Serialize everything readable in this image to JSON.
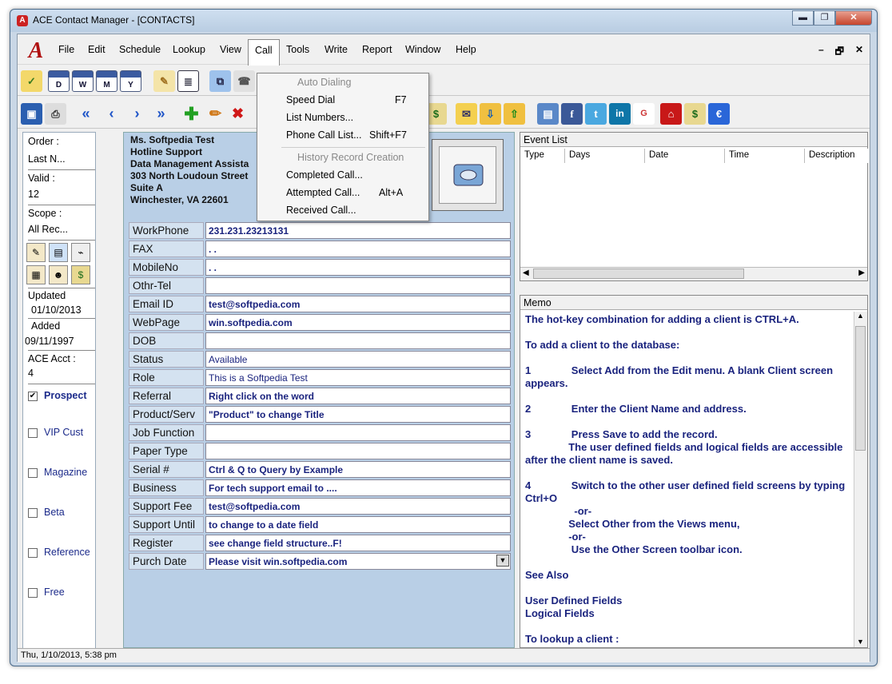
{
  "window": {
    "title": "ACE Contact Manager - [CONTACTS]",
    "min": "▬",
    "restore": "❐",
    "close": "✕",
    "mdi_min": "–",
    "mdi_restore": "🗗",
    "mdi_close": "✕"
  },
  "menu": [
    "File",
    "Edit",
    "Schedule",
    "Lookup",
    "View",
    "Call",
    "Tools",
    "Write",
    "Report",
    "Window",
    "Help"
  ],
  "call_menu": {
    "items": [
      {
        "label": "Auto Dialing",
        "key": "",
        "disabled": true
      },
      {
        "label": "Speed Dial",
        "key": "F7",
        "disabled": false
      },
      {
        "label": "List Numbers...",
        "key": "",
        "disabled": false
      },
      {
        "label": "Phone Call List...",
        "key": "Shift+F7",
        "disabled": false
      },
      {
        "label": "History Record Creation",
        "key": "",
        "disabled": true
      },
      {
        "label": "Completed Call...",
        "key": "",
        "disabled": false
      },
      {
        "label": "Attempted Call...",
        "key": "Alt+A",
        "disabled": false
      },
      {
        "label": "Received Call...",
        "key": "",
        "disabled": false
      }
    ]
  },
  "toolbar1": {
    "calendar_labels": [
      "D",
      "W",
      "M",
      "Y"
    ]
  },
  "left_panel": {
    "order_label": "Order :",
    "order_value": "Last N...",
    "valid_label": "Valid :",
    "valid_value": "12",
    "scope_label": "Scope :",
    "scope_value": "All Rec...",
    "updated_label": "Updated",
    "updated_value": "01/10/2013",
    "added_label": "Added",
    "added_value": "09/11/1997",
    "acct_label": "ACE Acct :",
    "acct_value": "4",
    "checkboxes": [
      {
        "label": "Prospect",
        "checked": true
      },
      {
        "label": "VIP Cust",
        "checked": false
      },
      {
        "label": "Magazine",
        "checked": false
      },
      {
        "label": "Beta",
        "checked": false
      },
      {
        "label": "Reference",
        "checked": false
      },
      {
        "label": "Free",
        "checked": false
      }
    ]
  },
  "contact": {
    "address_lines": [
      "Ms. Softpedia Test",
      "Hotline Support",
      "Data Management Assista",
      "303 North Loudoun Street",
      "Suite A",
      "Winchester, VA 22601"
    ]
  },
  "fields": [
    {
      "label": "WorkPhone",
      "value": "231.231.23213131",
      "bold": true
    },
    {
      "label": "FAX",
      "value": " .  .",
      "bold": true
    },
    {
      "label": "MobileNo",
      "value": " .  .",
      "bold": true
    },
    {
      "label": "Othr-Tel",
      "value": "",
      "bold": true
    },
    {
      "label": "Email ID",
      "value": "test@softpedia.com",
      "bold": true
    },
    {
      "label": "WebPage",
      "value": "win.softpedia.com",
      "bold": true
    },
    {
      "label": "DOB",
      "value": "",
      "bold": true
    },
    {
      "label": "Status",
      "value": "Available",
      "bold": false
    },
    {
      "label": "Role",
      "value": "This is a Softpedia Test",
      "bold": false
    },
    {
      "label": "Referral",
      "value": "Right click on the word",
      "bold": true
    },
    {
      "label": "Product/Serv",
      "value": "\"Product\" to change Title",
      "bold": true
    },
    {
      "label": "Job Function",
      "value": "",
      "bold": true
    },
    {
      "label": "Paper Type",
      "value": "",
      "bold": true
    },
    {
      "label": "Serial #",
      "value": "Ctrl & Q to Query by Example",
      "bold": true
    },
    {
      "label": "Business",
      "value": "For tech support email to ....",
      "bold": true
    },
    {
      "label": "Support Fee",
      "value": "test@softpedia.com",
      "bold": true
    },
    {
      "label": "Support Until",
      "value": "to change to a date field",
      "bold": true
    },
    {
      "label": "Register",
      "value": "see change field structure..F!",
      "bold": true
    },
    {
      "label": "Purch Date",
      "value": "Please visit win.softpedia.com",
      "bold": true
    }
  ],
  "event_list": {
    "title": "Event List",
    "columns": [
      "Type",
      "Days",
      "Date",
      "Time",
      "Description"
    ]
  },
  "memo": {
    "title": "Memo",
    "paragraphs": [
      "The hot-key combination for adding a client is CTRL+A.",
      "To add a client to the database:",
      "1              Select Add from the Edit menu. A blank Client screen appears.",
      "2              Enter the Client Name and address.",
      "3              Press Save to add the record.\n               The user defined fields and logical fields are accessible after the client name is saved.",
      "4              Switch to the other user defined field screens by typing Ctrl+O\n                 -or-\n               Select Other from the Views menu,\n               -or-\n                Use the Other Screen toolbar icon.",
      "See Also",
      "User Defined Fields\nLogical Fields",
      "To lookup a client :"
    ]
  },
  "status": {
    "text": "Thu, 1/10/2013, 5:38 pm"
  }
}
